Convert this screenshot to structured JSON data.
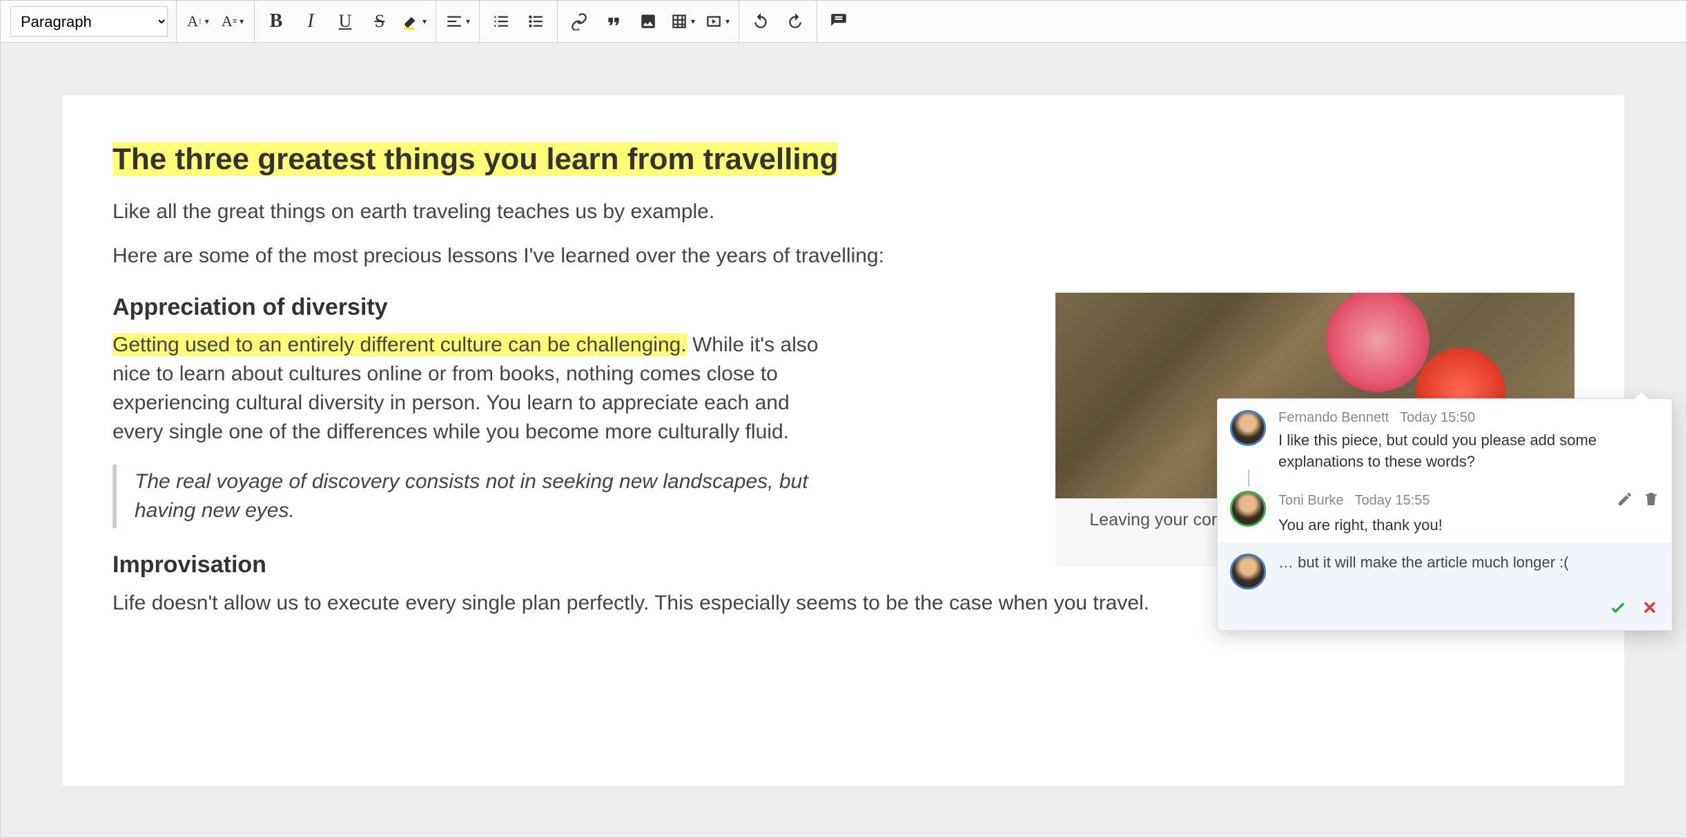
{
  "toolbar": {
    "heading_value": "Paragraph"
  },
  "doc": {
    "title": "The three greatest things you learn from travelling",
    "intro1": "Like all the great things on earth traveling teaches us by example.",
    "intro2": "Here are some of the most precious lessons I've learned over the years of travelling:",
    "sec1_heading": "Appreciation of diversity",
    "sec1_hl": "Getting used to an entirely different culture can be challenging.",
    "sec1_rest": " While it's also nice to learn about cultures online or from books, nothing comes close to experiencing cultural diversity in person. You learn to appreciate each and every single one of the differences while you become more culturally fluid.",
    "quote": "The real voyage of discovery consists not in seeking new landscapes, but having new eyes.",
    "sec2_heading": "Improvisation",
    "sec2_body": "Life doesn't allow us to execute every single plan perfectly. This especially seems to be the case when you travel.",
    "figure_caption": "Leaving your comfort zone might lead you to such beautiful sceneries like this one."
  },
  "comment_markers": {
    "m1_count": "1",
    "m2_count": "2"
  },
  "thread": {
    "c1_author": "Fernando Bennett",
    "c1_time": "Today 15:50",
    "c1_text": "I like this piece, but could you please add some explanations to these words?",
    "c2_author": "Toni Burke",
    "c2_time": "Today 15:55",
    "c2_text": "You are right, thank you!",
    "draft": "… but it will make the article much longer :("
  }
}
